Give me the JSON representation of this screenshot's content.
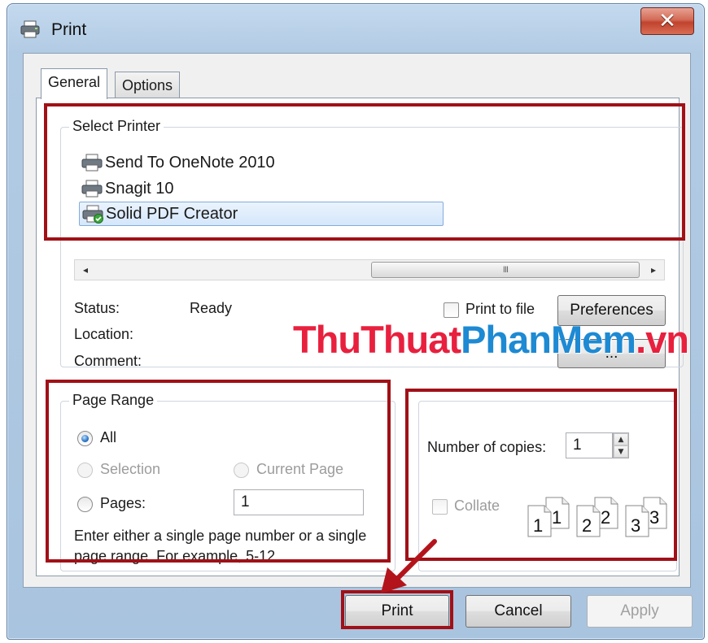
{
  "window": {
    "title": "Print",
    "close_glyph": "✕"
  },
  "tabs": [
    {
      "label": "General",
      "active": true
    },
    {
      "label": "Options",
      "active": false
    }
  ],
  "printer_group": {
    "legend": "Select Printer",
    "printers": [
      {
        "name": "Send To OneNote 2010",
        "icon": "printer-icon",
        "selected": false
      },
      {
        "name": "Snagit 10",
        "icon": "printer-icon",
        "selected": false
      },
      {
        "name": "Solid PDF Creator",
        "icon": "default-printer-icon",
        "selected": true
      }
    ],
    "scrollbar": {
      "left_arrow": "◂",
      "right_arrow": "▸",
      "thumb_grip": "III"
    },
    "status_label": "Status:",
    "status_value": "Ready",
    "location_label": "Location:",
    "comment_label": "Comment:",
    "print_to_file_label": "Print to file",
    "print_to_file_checked": false,
    "preferences_label": "Preferences",
    "find_printer_label": "..."
  },
  "page_range": {
    "legend": "Page Range",
    "all_label": "All",
    "selection_label": "Selection",
    "current_page_label": "Current Page",
    "pages_label": "Pages:",
    "pages_value": "1",
    "help_text_line1": "Enter either a single page number or a single",
    "help_text_line2": "page range.  For example, 5-12",
    "selected_option": "All"
  },
  "copies": {
    "number_label": "Number of copies:",
    "number_value": "1",
    "spin_up": "▲",
    "spin_down": "▼",
    "collate_label": "Collate",
    "collate_checked": false,
    "collate_pages": [
      {
        "back": "1",
        "front": "1"
      },
      {
        "back": "2",
        "front": "2"
      },
      {
        "back": "3",
        "front": "3"
      }
    ]
  },
  "buttons": {
    "print_label": "Print",
    "cancel_label": "Cancel",
    "apply_label": "Apply"
  },
  "watermark": {
    "part1": "ThuThuat",
    "part2": "PhanMem",
    "part3": ".vn"
  },
  "colors": {
    "highlight": "#a11017",
    "watermark_red": "#e8203e",
    "watermark_blue": "#1d8ad3",
    "selection_bg": "#d5e7fb"
  }
}
